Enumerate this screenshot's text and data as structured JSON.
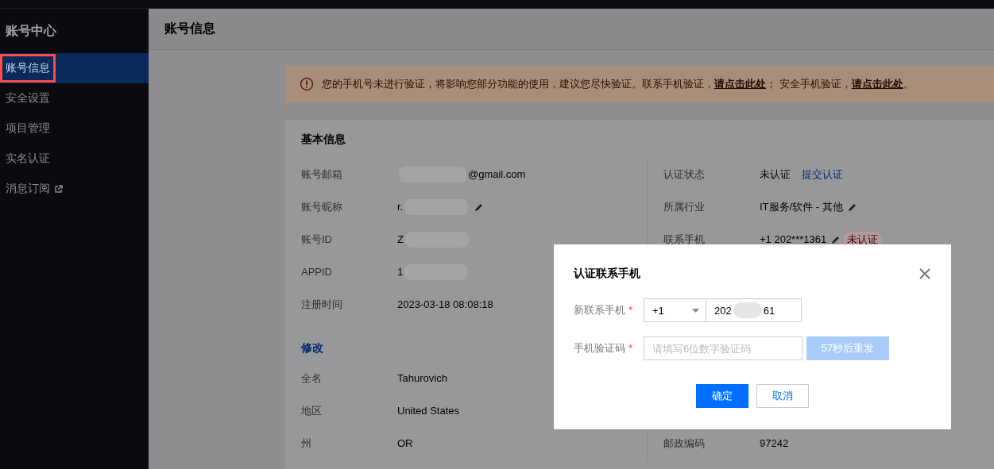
{
  "sidebar": {
    "title": "账号中心",
    "items": [
      {
        "label": "账号信息",
        "selected": true,
        "highlighted": true,
        "external": false
      },
      {
        "label": "安全设置",
        "selected": false,
        "highlighted": false,
        "external": false
      },
      {
        "label": "项目管理",
        "selected": false,
        "highlighted": false,
        "external": false
      },
      {
        "label": "实名认证",
        "selected": false,
        "highlighted": false,
        "external": false
      },
      {
        "label": "消息订阅",
        "selected": false,
        "highlighted": false,
        "external": true
      }
    ]
  },
  "header": {
    "title": "账号信息"
  },
  "alert": {
    "parts": [
      {
        "kind": "text",
        "text": "您的手机号未进行验证，将影响您部分功能的使用，建议您尽快验证。联系手机验证，"
      },
      {
        "kind": "link",
        "text": "请点击此处"
      },
      {
        "kind": "text",
        "text": "； 安全手机验证，"
      },
      {
        "kind": "link",
        "text": "请点击此处"
      },
      {
        "kind": "text",
        "text": "。"
      }
    ]
  },
  "basic_info": {
    "title": "基本信息",
    "left_rows": [
      {
        "label": "账号邮箱",
        "value": "@gmail.com",
        "blurred_before": true,
        "blurred_after": false,
        "editable": false
      },
      {
        "label": "账号昵称",
        "value": "r.",
        "blurred_before": false,
        "blurred_after": true,
        "editable": true
      },
      {
        "label": "账号ID",
        "value": "Z",
        "blurred_before": false,
        "blurred_after": true,
        "editable": false
      },
      {
        "label": "APPID",
        "value": "1",
        "blurred_before": false,
        "blurred_after": true,
        "editable": false
      },
      {
        "label": "注册时间",
        "value": "2023-03-18 08:08:18",
        "blurred_before": false,
        "blurred_after": false,
        "editable": false
      }
    ],
    "right_rows": [
      {
        "label": "认证状态",
        "value": "未认证",
        "link": "提交认证",
        "editable": false
      },
      {
        "label": "所属行业",
        "value": "IT服务/软件 - 其他",
        "editable": true
      },
      {
        "label": "联系手机",
        "value": "+1 202***1361",
        "editable": true,
        "tag": "未认证"
      }
    ],
    "edit_link": "修改",
    "detail_rows": [
      {
        "label": "全名",
        "value": "Tahurovich"
      },
      {
        "label": "地区",
        "value": "United States"
      },
      {
        "label": "州",
        "value": "OR"
      }
    ],
    "bottom_right_rows": [
      {
        "label": "邮政编码",
        "value": "97242"
      }
    ]
  },
  "dialog": {
    "title": "认证联系手机",
    "phone_label": "新联系手机",
    "phone_required_mark": "*",
    "country_code": "+1",
    "phone_value_parts": [
      "202",
      "61"
    ],
    "code_label": "手机验证码",
    "code_required_mark": "*",
    "code_placeholder": "请填写6位数字验证码",
    "resend_button": {
      "label": "57秒后重发",
      "disabled": true
    },
    "buttons": [
      {
        "label": "确定",
        "kind": "primary"
      },
      {
        "label": "取消",
        "kind": "secondary"
      }
    ]
  }
}
